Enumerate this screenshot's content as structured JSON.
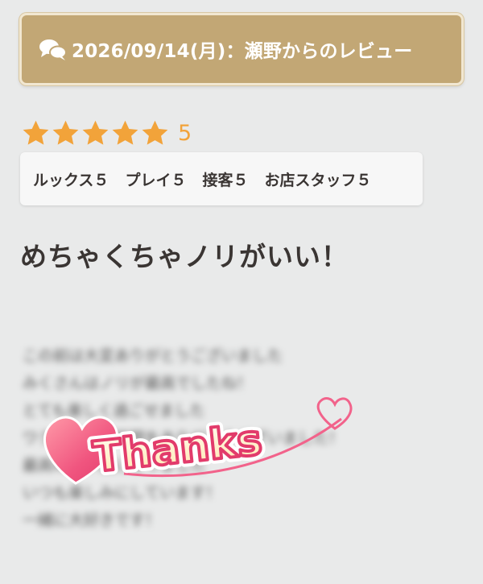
{
  "header": {
    "icon": "chat-bubbles-icon",
    "title": "2026/09/14(月)：瀬野からのレビュー"
  },
  "rating": {
    "stars_filled": 5,
    "stars_total": 5,
    "value": "5",
    "star_color": "#f2a33a"
  },
  "scores": [
    {
      "label": "ルックス５"
    },
    {
      "label": "プレイ５"
    },
    {
      "label": "接客５"
    },
    {
      "label": "お店スタッフ５"
    }
  ],
  "review": {
    "title": "めちゃくちゃノリがいい！",
    "blurred_lines": [
      "この前は大変ありがとうございました",
      "みくさんはノリが最高でしたね！",
      "とても楽しく過ごせました",
      "ワクワクする時間をありがとうございました！",
      "最高の思い出になりました",
      "いつも楽しみにしています！",
      "一緒に大好きです！"
    ]
  },
  "stamp": {
    "text": "Thanks",
    "icon": "thanks-heart-stamp-icon"
  },
  "colors": {
    "header_bg": "#c2a775",
    "header_border": "#f1e7d1",
    "page_bg": "#e9eaea",
    "text": "#3a3533",
    "heart_pink": "#f0557f"
  }
}
